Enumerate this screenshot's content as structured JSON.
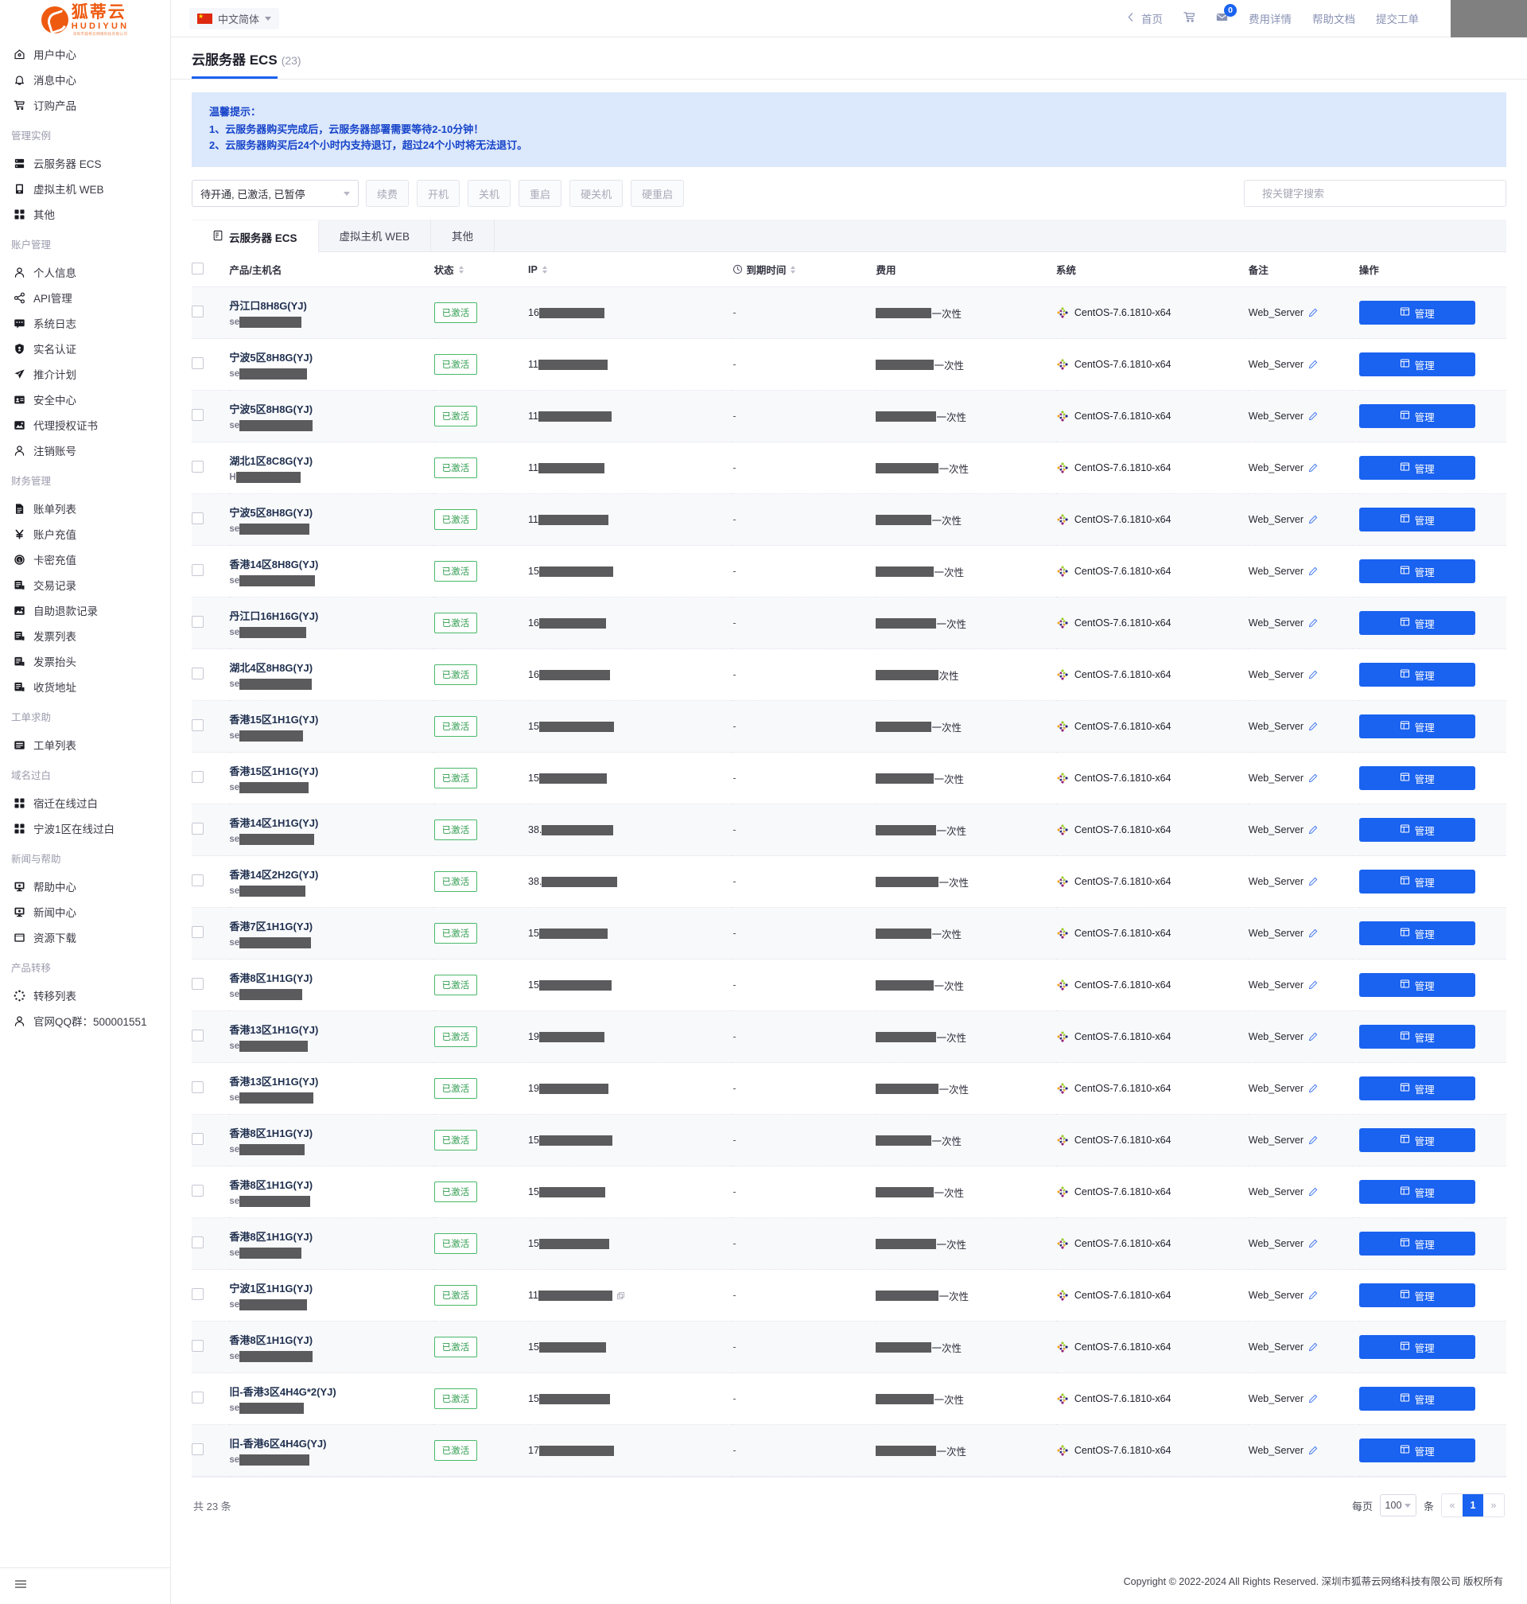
{
  "brand": {
    "name_cn": "狐蒂云",
    "name_en": "HUDIYUN",
    "sub": "深圳市狐蒂云网络科技有限公司"
  },
  "topbar": {
    "language": "中文简体",
    "links": [
      {
        "label": "首页",
        "icon": "home-back-icon"
      },
      {
        "label": "",
        "icon": "cart-icon"
      },
      {
        "label": "",
        "icon": "mail-icon",
        "badge": "0"
      },
      {
        "label": "费用详情",
        "icon": ""
      },
      {
        "label": "帮助文档",
        "icon": ""
      },
      {
        "label": "提交工单",
        "icon": ""
      }
    ]
  },
  "sidebar": {
    "items": [
      {
        "label": "用户中心",
        "icon": "home-icon",
        "type": "item"
      },
      {
        "label": "消息中心",
        "icon": "bell-icon",
        "type": "item"
      },
      {
        "label": "订购产品",
        "icon": "cart-icon",
        "type": "item"
      },
      {
        "label": "管理实例",
        "type": "group"
      },
      {
        "label": "云服务器 ECS",
        "icon": "server-icon",
        "type": "item"
      },
      {
        "label": "虚拟主机 WEB",
        "icon": "web-host-icon",
        "type": "item"
      },
      {
        "label": "其他",
        "icon": "grid-icon",
        "type": "item"
      },
      {
        "label": "账户管理",
        "type": "group"
      },
      {
        "label": "个人信息",
        "icon": "user-icon",
        "type": "item"
      },
      {
        "label": "API管理",
        "icon": "share-icon",
        "type": "item"
      },
      {
        "label": "系统日志",
        "icon": "log-icon",
        "type": "item"
      },
      {
        "label": "实名认证",
        "icon": "shield-icon",
        "type": "item"
      },
      {
        "label": "推介计划",
        "icon": "promo-icon",
        "type": "item"
      },
      {
        "label": "安全中心",
        "icon": "id-card-icon",
        "type": "item"
      },
      {
        "label": "代理授权证书",
        "icon": "certificate-icon",
        "type": "item"
      },
      {
        "label": "注销账号",
        "icon": "user-icon",
        "type": "item"
      },
      {
        "label": "财务管理",
        "type": "group"
      },
      {
        "label": "账单列表",
        "icon": "doc-icon",
        "type": "item"
      },
      {
        "label": "账户充值",
        "icon": "yen-icon",
        "type": "item"
      },
      {
        "label": "卡密充值",
        "icon": "coin-icon",
        "type": "item"
      },
      {
        "label": "交易记录",
        "icon": "record-icon",
        "type": "item"
      },
      {
        "label": "自助退款记录",
        "icon": "refund-icon",
        "type": "item"
      },
      {
        "label": "发票列表",
        "icon": "record-icon",
        "type": "item"
      },
      {
        "label": "发票抬头",
        "icon": "record-icon",
        "type": "item"
      },
      {
        "label": "收货地址",
        "icon": "record-icon",
        "type": "item"
      },
      {
        "label": "工单求助",
        "type": "group"
      },
      {
        "label": "工单列表",
        "icon": "ticket-icon",
        "type": "item"
      },
      {
        "label": "域名过白",
        "type": "group"
      },
      {
        "label": "宿迁在线过白",
        "icon": "grid-icon",
        "type": "item"
      },
      {
        "label": "宁波1区在线过白",
        "icon": "grid-icon",
        "type": "item"
      },
      {
        "label": "新闻与帮助",
        "type": "group"
      },
      {
        "label": "帮助中心",
        "icon": "monitor-icon",
        "type": "item"
      },
      {
        "label": "新闻中心",
        "icon": "monitor-icon",
        "type": "item"
      },
      {
        "label": "资源下载",
        "icon": "download-box-icon",
        "type": "item"
      },
      {
        "label": "产品转移",
        "type": "group"
      },
      {
        "label": "转移列表",
        "icon": "transfer-icon",
        "type": "item"
      },
      {
        "label": "官网QQ群：500001551",
        "icon": "user-icon",
        "type": "item"
      }
    ]
  },
  "page": {
    "title": "云服务器 ECS",
    "count": "(23)"
  },
  "notice": {
    "title": "温馨提示：",
    "line1": "1、云服务器购买完成后，云服务器部署需要等待2-10分钟！",
    "line2": "2、云服务器购买后24个小时内支持退订，超过24个小时将无法退订。"
  },
  "toolbar": {
    "status_filter": "待开通, 已激活, 已暂停",
    "buttons": [
      "续费",
      "开机",
      "关机",
      "重启",
      "硬关机",
      "硬重启"
    ],
    "search_placeholder": "按关键字搜索",
    "search_value": ""
  },
  "tabs": [
    {
      "label": "云服务器 ECS",
      "active": true
    },
    {
      "label": "虚拟主机 WEB",
      "active": false
    },
    {
      "label": "其他",
      "active": false
    }
  ],
  "table": {
    "columns": [
      {
        "label": "产品/主机名",
        "sortable": false
      },
      {
        "label": "状态",
        "sortable": true
      },
      {
        "label": "IP",
        "sortable": true
      },
      {
        "label": "到期时间",
        "sortable": true,
        "icon": "clock-icon"
      },
      {
        "label": "费用",
        "sortable": false
      },
      {
        "label": "系统",
        "sortable": false
      },
      {
        "label": "备注",
        "sortable": false
      },
      {
        "label": "操作",
        "sortable": false
      }
    ],
    "status_label": "已激活",
    "expire_label": "-",
    "fee_suffix": "一次性",
    "os_label": "CentOS-7.6.1810-x64",
    "remark_label": "Web_Server",
    "action_label": "管理",
    "host_prefix": "se",
    "rows": [
      {
        "name": "丹江口8H8G(YJ)",
        "host_prefix": "se",
        "ip_prefix": "16",
        "fee_suffix": "一次性"
      },
      {
        "name": "宁波5区8H8G(YJ)",
        "host_prefix": "se",
        "ip_prefix": "11",
        "fee_suffix": "一次性"
      },
      {
        "name": "宁波5区8H8G(YJ)",
        "host_prefix": "se",
        "ip_prefix": "11",
        "fee_suffix": "一次性"
      },
      {
        "name": "湖北1区8C8G(YJ)",
        "host_prefix": "H",
        "ip_prefix": "11",
        "fee_suffix": "一次性"
      },
      {
        "name": "宁波5区8H8G(YJ)",
        "host_prefix": "se",
        "ip_prefix": "11",
        "fee_suffix": "一次性"
      },
      {
        "name": "香港14区8H8G(YJ)",
        "host_prefix": "se",
        "ip_prefix": "15",
        "fee_suffix": "一次性"
      },
      {
        "name": "丹江口16H16G(YJ)",
        "host_prefix": "se",
        "ip_prefix": "16",
        "fee_suffix": "一次性"
      },
      {
        "name": "湖北4区8H8G(YJ)",
        "host_prefix": "se",
        "ip_prefix": "16",
        "fee_suffix": "次性"
      },
      {
        "name": "香港15区1H1G(YJ)",
        "host_prefix": "se",
        "ip_prefix": "15",
        "fee_suffix": "一次性"
      },
      {
        "name": "香港15区1H1G(YJ)",
        "host_prefix": "se",
        "ip_prefix": "15",
        "fee_suffix": "一次性"
      },
      {
        "name": "香港14区1H1G(YJ)",
        "host_prefix": "se",
        "ip_prefix": "38.",
        "fee_suffix": "一次性"
      },
      {
        "name": "香港14区2H2G(YJ)",
        "host_prefix": "se",
        "ip_prefix": "38.",
        "fee_suffix": "一次性"
      },
      {
        "name": "香港7区1H1G(YJ)",
        "host_prefix": "se",
        "ip_prefix": "15",
        "fee_suffix": "一次性"
      },
      {
        "name": "香港8区1H1G(YJ)",
        "host_prefix": "se",
        "ip_prefix": "15",
        "fee_suffix": "一次性"
      },
      {
        "name": "香港13区1H1G(YJ)",
        "host_prefix": "se",
        "ip_prefix": "19",
        "fee_suffix": "一次性"
      },
      {
        "name": "香港13区1H1G(YJ)",
        "host_prefix": "se",
        "ip_prefix": "19",
        "fee_suffix": "一次性"
      },
      {
        "name": "香港8区1H1G(YJ)",
        "host_prefix": "se",
        "ip_prefix": "15",
        "fee_suffix": "一次性"
      },
      {
        "name": "香港8区1H1G(YJ)",
        "host_prefix": "se",
        "ip_prefix": "15",
        "fee_suffix": "一次性"
      },
      {
        "name": "香港8区1H1G(YJ)",
        "host_prefix": "se",
        "ip_prefix": "15",
        "fee_suffix": "一次性"
      },
      {
        "name": "宁波1区1H1G(YJ)",
        "host_prefix": "se",
        "ip_prefix": "11",
        "fee_suffix": "一次性",
        "copyable": true
      },
      {
        "name": "香港8区1H1G(YJ)",
        "host_prefix": "se",
        "ip_prefix": "15",
        "fee_suffix": "一次性"
      },
      {
        "name": "旧-香港3区4H4G*2(YJ)",
        "host_prefix": "se",
        "ip_prefix": "15",
        "fee_suffix": "一次性"
      },
      {
        "name": "旧-香港6区4H4G(YJ)",
        "host_prefix": "se",
        "ip_prefix": "17",
        "fee_suffix": "一次性"
      }
    ]
  },
  "footer": {
    "total": "共 23 条",
    "per_page_label": "每页",
    "per_page_value": "100",
    "per_page_unit": "条",
    "prev": "«",
    "current_page": "1",
    "next": "»",
    "copyright": "Copyright © 2022-2024 All Rights Reserved. 深圳市狐蒂云网络科技有限公司 版权所有"
  },
  "colors": {
    "accent": "#1a62f0",
    "brand": "#ee5a10",
    "success": "#49b869",
    "notice_bg": "#dce8fb"
  }
}
